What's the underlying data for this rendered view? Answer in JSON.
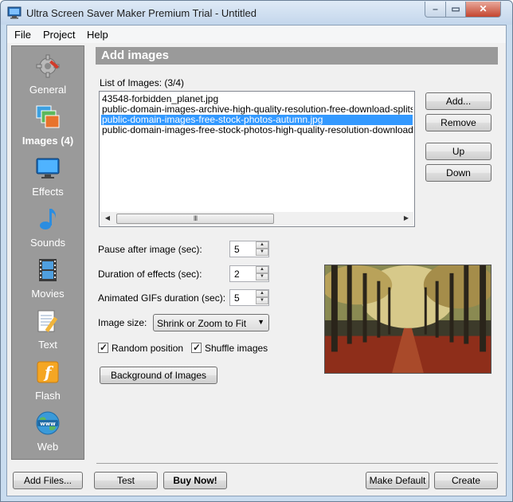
{
  "window": {
    "title": "Ultra Screen Saver Maker Premium Trial - Untitled",
    "close_glyph": "✕",
    "minimize_glyph": "–",
    "maximize_glyph": "▭"
  },
  "menu": [
    "File",
    "Project",
    "Help"
  ],
  "sidebar": {
    "items": [
      {
        "label": "General",
        "icon": "gear-icon",
        "active": false
      },
      {
        "label": "Images (4)",
        "icon": "images-icon",
        "active": true
      },
      {
        "label": "Effects",
        "icon": "effects-monitor-icon",
        "active": false
      },
      {
        "label": "Sounds",
        "icon": "music-note-icon",
        "active": false
      },
      {
        "label": "Movies",
        "icon": "film-strip-icon",
        "active": false
      },
      {
        "label": "Text",
        "icon": "notepad-pencil-icon",
        "active": false
      },
      {
        "label": "Flash",
        "icon": "flash-icon",
        "active": false
      },
      {
        "label": "Web",
        "icon": "globe-www-icon",
        "active": false
      }
    ]
  },
  "panel": {
    "title": "Add images",
    "list_caption": "List of Images:  (3/4)",
    "images": [
      "43548-forbidden_planet.jpg",
      "public-domain-images-archive-high-quality-resolution-free-download-splitshire",
      "public-domain-images-free-stock-photos-autumn.jpg",
      "public-domain-images-free-stock-photos-high-quality-resolution-downloads-ar"
    ],
    "selected_index": 2,
    "scroll_grip": "III",
    "buttons": {
      "add": "Add...",
      "remove": "Remove",
      "up": "Up",
      "down": "Down",
      "background": "Background of Images"
    },
    "pause_label": "Pause after image (sec):",
    "pause_value": "5",
    "effects_label": "Duration of effects (sec):",
    "effects_value": "2",
    "gifs_label": "Animated GIFs duration (sec):",
    "gifs_value": "5",
    "size_label": "Image size:",
    "size_value": "Shrink or Zoom to Fit",
    "random_label": "Random position",
    "random_checked": true,
    "shuffle_label": "Shuffle images",
    "shuffle_checked": true
  },
  "footer": {
    "add_files": "Add Files...",
    "test": "Test",
    "buy": "Buy Now!",
    "make_default": "Make Default",
    "create": "Create"
  },
  "colors": {
    "selection": "#3399ff",
    "sidebar_bg": "#9a9a9a",
    "header_bg": "#9a9a9a"
  }
}
